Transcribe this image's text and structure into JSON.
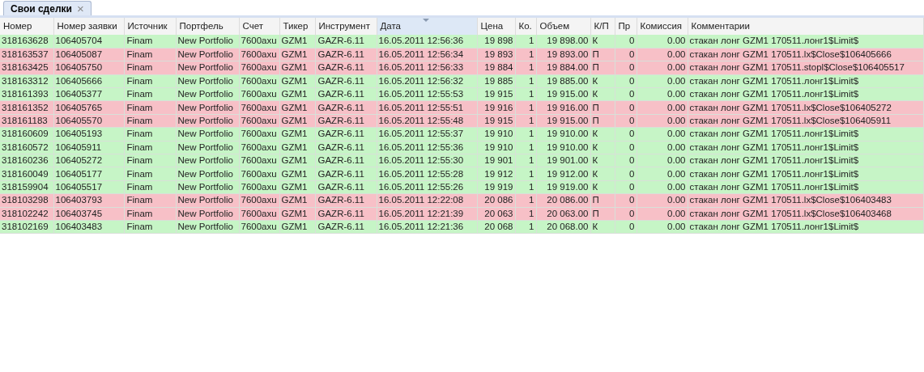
{
  "tabs": [
    {
      "label": "Свои сделки",
      "close": "×",
      "selected": true
    }
  ],
  "table": {
    "columns": [
      {
        "label": "Номер",
        "sorted": false
      },
      {
        "label": "Номер заявки",
        "sorted": false
      },
      {
        "label": "Источник",
        "sorted": false
      },
      {
        "label": "Портфель",
        "sorted": false
      },
      {
        "label": "Счет",
        "sorted": false
      },
      {
        "label": "Тикер",
        "sorted": false
      },
      {
        "label": "Инструмент",
        "sorted": false
      },
      {
        "label": "Дата",
        "sorted": true
      },
      {
        "label": "Цена",
        "sorted": false
      },
      {
        "label": "Ко.",
        "sorted": false
      },
      {
        "label": "Объем",
        "sorted": false
      },
      {
        "label": "К/П",
        "sorted": false
      },
      {
        "label": "Пр",
        "sorted": false
      },
      {
        "label": "Комиссия",
        "sorted": false
      },
      {
        "label": "Комментарии",
        "sorted": false
      }
    ],
    "rows": [
      {
        "kind": "buy",
        "cells": [
          "318163628",
          "106405704",
          "Finam",
          "New Portfolio",
          "7600axu",
          "GZM1",
          "GAZR-6.11",
          "16.05.2011 12:56:36",
          "19 898",
          "1",
          "19 898.00",
          "К",
          "0",
          "0.00",
          "стакан лонг GZM1 170511.лонг1$Limit$"
        ]
      },
      {
        "kind": "sell",
        "cells": [
          "318163537",
          "106405087",
          "Finam",
          "New Portfolio",
          "7600axu",
          "GZM1",
          "GAZR-6.11",
          "16.05.2011 12:56:34",
          "19 893",
          "1",
          "19 893.00",
          "П",
          "0",
          "0.00",
          "стакан лонг GZM1 170511.lx$Close$106405666"
        ]
      },
      {
        "kind": "sell",
        "cells": [
          "318163425",
          "106405750",
          "Finam",
          "New Portfolio",
          "7600axu",
          "GZM1",
          "GAZR-6.11",
          "16.05.2011 12:56:33",
          "19 884",
          "1",
          "19 884.00",
          "П",
          "0",
          "0.00",
          "стакан лонг GZM1 170511.stopl$Close$106405517"
        ]
      },
      {
        "kind": "buy",
        "cells": [
          "318163312",
          "106405666",
          "Finam",
          "New Portfolio",
          "7600axu",
          "GZM1",
          "GAZR-6.11",
          "16.05.2011 12:56:32",
          "19 885",
          "1",
          "19 885.00",
          "К",
          "0",
          "0.00",
          "стакан лонг GZM1 170511.лонг1$Limit$"
        ]
      },
      {
        "kind": "buy",
        "cells": [
          "318161393",
          "106405377",
          "Finam",
          "New Portfolio",
          "7600axu",
          "GZM1",
          "GAZR-6.11",
          "16.05.2011 12:55:53",
          "19 915",
          "1",
          "19 915.00",
          "К",
          "0",
          "0.00",
          "стакан лонг GZM1 170511.лонг1$Limit$"
        ]
      },
      {
        "kind": "sell",
        "cells": [
          "318161352",
          "106405765",
          "Finam",
          "New Portfolio",
          "7600axu",
          "GZM1",
          "GAZR-6.11",
          "16.05.2011 12:55:51",
          "19 916",
          "1",
          "19 916.00",
          "П",
          "0",
          "0.00",
          "стакан лонг GZM1 170511.lx$Close$106405272"
        ]
      },
      {
        "kind": "sell",
        "cells": [
          "318161183",
          "106405570",
          "Finam",
          "New Portfolio",
          "7600axu",
          "GZM1",
          "GAZR-6.11",
          "16.05.2011 12:55:48",
          "19 915",
          "1",
          "19 915.00",
          "П",
          "0",
          "0.00",
          "стакан лонг GZM1 170511.lx$Close$106405911"
        ]
      },
      {
        "kind": "buy",
        "cells": [
          "318160609",
          "106405193",
          "Finam",
          "New Portfolio",
          "7600axu",
          "GZM1",
          "GAZR-6.11",
          "16.05.2011 12:55:37",
          "19 910",
          "1",
          "19 910.00",
          "К",
          "0",
          "0.00",
          "стакан лонг GZM1 170511.лонг1$Limit$"
        ]
      },
      {
        "kind": "buy",
        "cells": [
          "318160572",
          "106405911",
          "Finam",
          "New Portfolio",
          "7600axu",
          "GZM1",
          "GAZR-6.11",
          "16.05.2011 12:55:36",
          "19 910",
          "1",
          "19 910.00",
          "К",
          "0",
          "0.00",
          "стакан лонг GZM1 170511.лонг1$Limit$"
        ]
      },
      {
        "kind": "buy",
        "cells": [
          "318160236",
          "106405272",
          "Finam",
          "New Portfolio",
          "7600axu",
          "GZM1",
          "GAZR-6.11",
          "16.05.2011 12:55:30",
          "19 901",
          "1",
          "19 901.00",
          "К",
          "0",
          "0.00",
          "стакан лонг GZM1 170511.лонг1$Limit$"
        ]
      },
      {
        "kind": "buy",
        "cells": [
          "318160049",
          "106405177",
          "Finam",
          "New Portfolio",
          "7600axu",
          "GZM1",
          "GAZR-6.11",
          "16.05.2011 12:55:28",
          "19 912",
          "1",
          "19 912.00",
          "К",
          "0",
          "0.00",
          "стакан лонг GZM1 170511.лонг1$Limit$"
        ]
      },
      {
        "kind": "buy",
        "cells": [
          "318159904",
          "106405517",
          "Finam",
          "New Portfolio",
          "7600axu",
          "GZM1",
          "GAZR-6.11",
          "16.05.2011 12:55:26",
          "19 919",
          "1",
          "19 919.00",
          "К",
          "0",
          "0.00",
          "стакан лонг GZM1 170511.лонг1$Limit$"
        ]
      },
      {
        "kind": "sell",
        "cells": [
          "318103298",
          "106403793",
          "Finam",
          "New Portfolio",
          "7600axu",
          "GZM1",
          "GAZR-6.11",
          "16.05.2011 12:22:08",
          "20 086",
          "1",
          "20 086.00",
          "П",
          "0",
          "0.00",
          "стакан лонг GZM1 170511.lx$Close$106403483"
        ]
      },
      {
        "kind": "sell",
        "cells": [
          "318102242",
          "106403745",
          "Finam",
          "New Portfolio",
          "7600axu",
          "GZM1",
          "GAZR-6.11",
          "16.05.2011 12:21:39",
          "20 063",
          "1",
          "20 063.00",
          "П",
          "0",
          "0.00",
          "стакан лонг GZM1 170511.lx$Close$106403468"
        ]
      },
      {
        "kind": "buy",
        "cells": [
          "318102169",
          "106403483",
          "Finam",
          "New Portfolio",
          "7600axu",
          "GZM1",
          "GAZR-6.11",
          "16.05.2011 12:21:36",
          "20 068",
          "1",
          "20 068.00",
          "К",
          "0",
          "0.00",
          "стакан лонг GZM1 170511.лонг1$Limit$"
        ]
      }
    ]
  }
}
